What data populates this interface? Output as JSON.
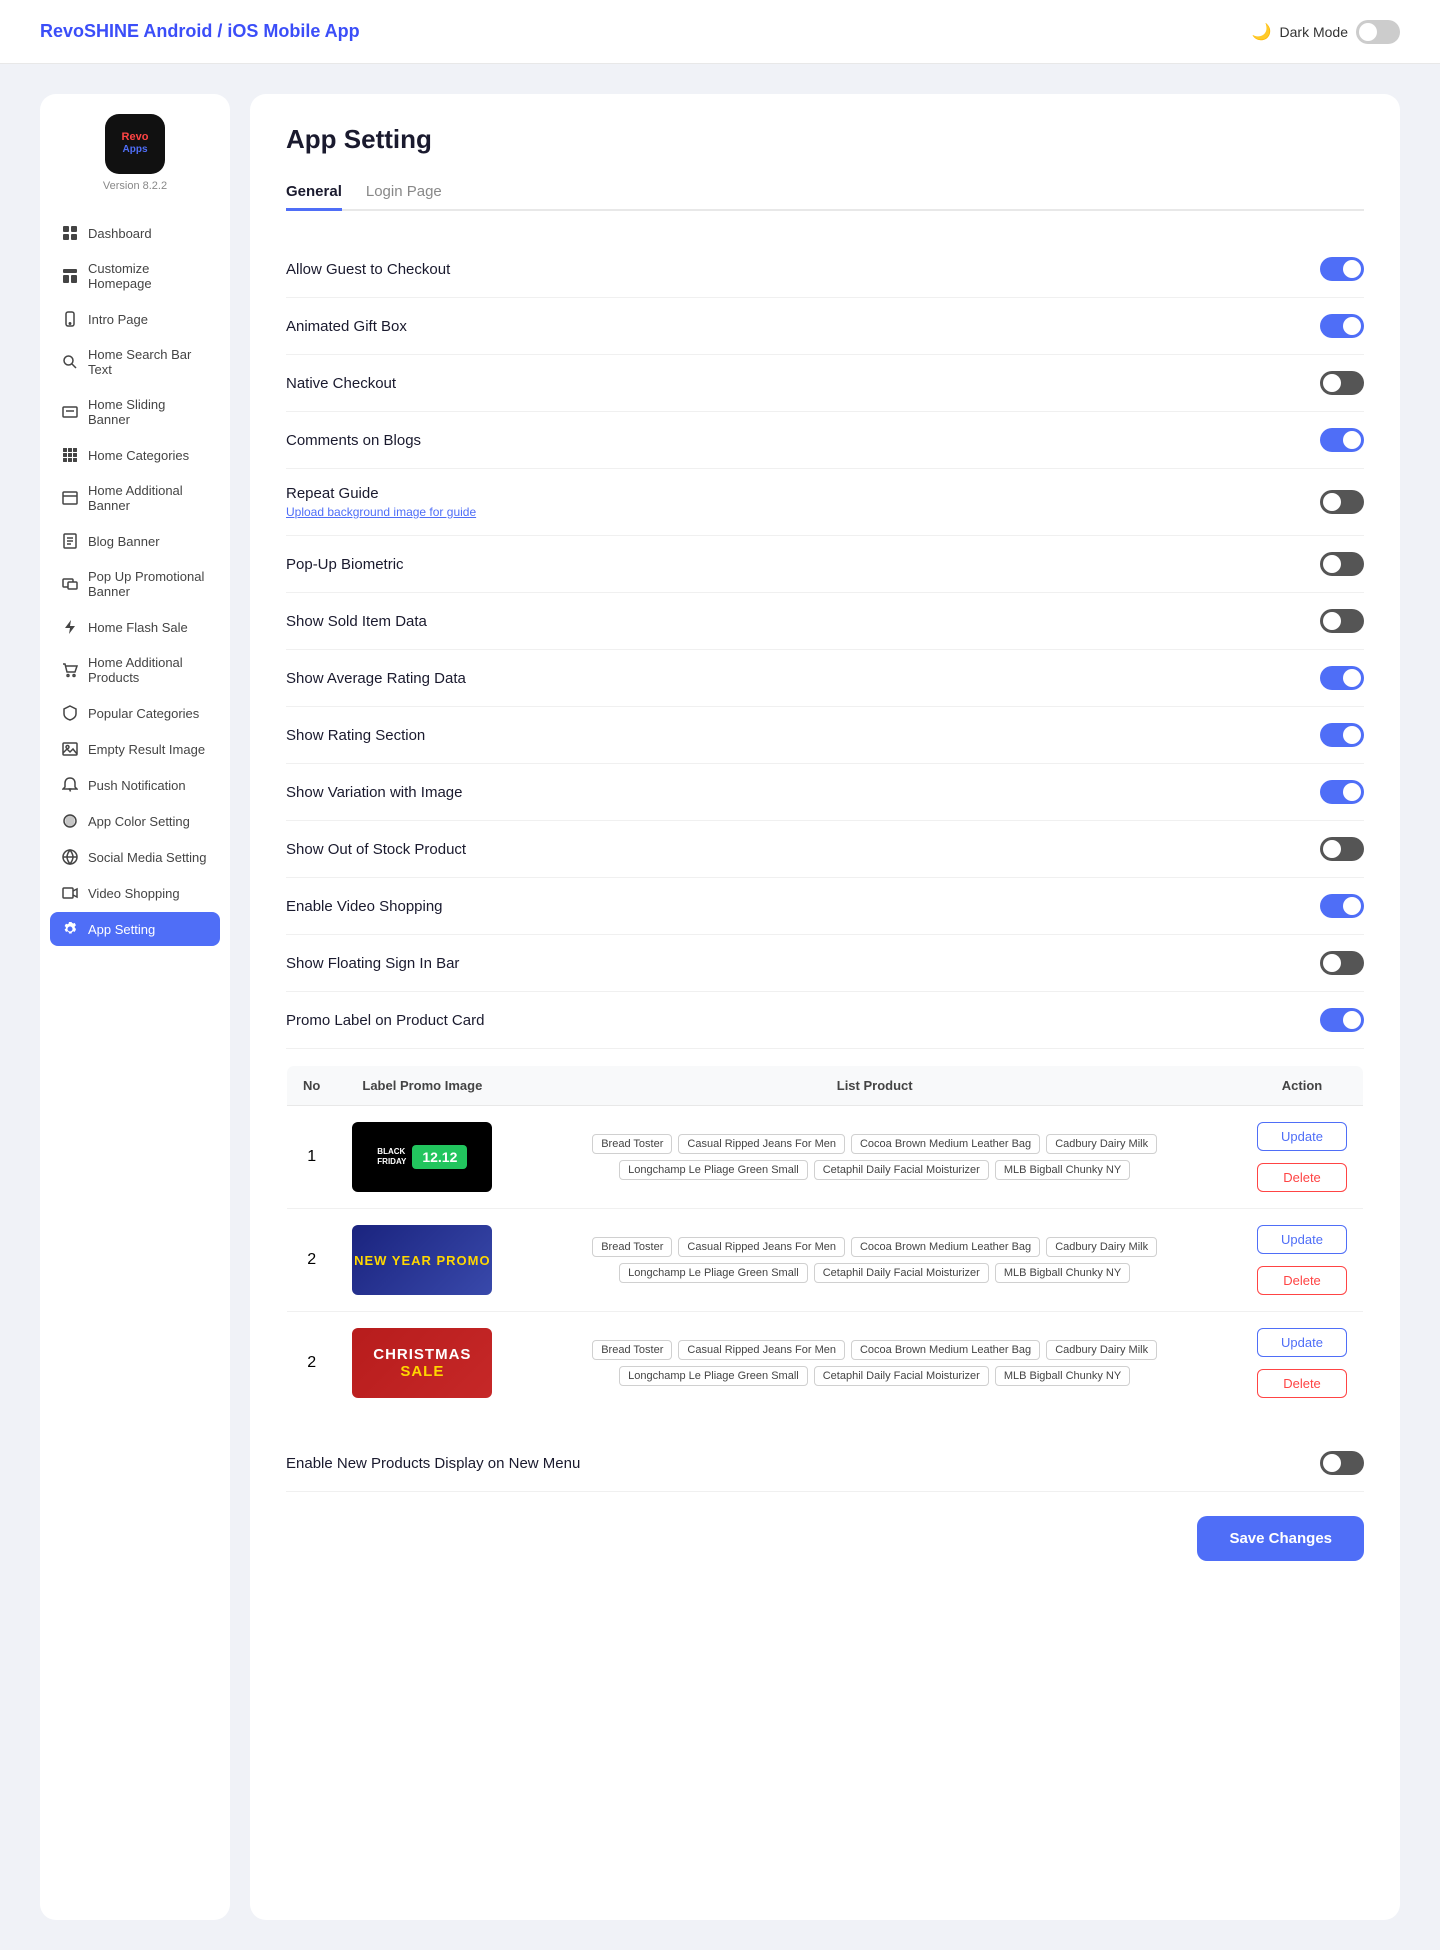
{
  "header": {
    "title": "RevoSHINE Android / iOS Mobile App",
    "darkMode": "Dark Mode"
  },
  "logo": {
    "version": "Version 8.2.2",
    "revo": "Revo",
    "apps": "Apps"
  },
  "nav": {
    "items": [
      {
        "id": "dashboard",
        "label": "Dashboard",
        "icon": "grid"
      },
      {
        "id": "customize-homepage",
        "label": "Customize Homepage",
        "icon": "layout"
      },
      {
        "id": "intro-page",
        "label": "Intro Page",
        "icon": "phone"
      },
      {
        "id": "home-search-bar",
        "label": "Home Search Bar Text",
        "icon": "search"
      },
      {
        "id": "home-sliding-banner",
        "label": "Home Sliding Banner",
        "icon": "image"
      },
      {
        "id": "home-categories",
        "label": "Home Categories",
        "icon": "grid4"
      },
      {
        "id": "home-additional-banner",
        "label": "Home Additional Banner",
        "icon": "banner"
      },
      {
        "id": "blog-banner",
        "label": "Blog Banner",
        "icon": "blog"
      },
      {
        "id": "popup-promotional",
        "label": "Pop Up Promotional Banner",
        "icon": "popup"
      },
      {
        "id": "home-flash-sale",
        "label": "Home Flash Sale",
        "icon": "flash"
      },
      {
        "id": "home-additional-products",
        "label": "Home Additional Products",
        "icon": "cart"
      },
      {
        "id": "popular-categories",
        "label": "Popular Categories",
        "icon": "shield"
      },
      {
        "id": "empty-result",
        "label": "Empty Result Image",
        "icon": "image2"
      },
      {
        "id": "push-notification",
        "label": "Push Notification",
        "icon": "bell"
      },
      {
        "id": "app-color-setting",
        "label": "App Color Setting",
        "icon": "color"
      },
      {
        "id": "social-media",
        "label": "Social Media Setting",
        "icon": "globe"
      },
      {
        "id": "video-shopping",
        "label": "Video Shopping",
        "icon": "video"
      },
      {
        "id": "app-setting",
        "label": "App Setting",
        "icon": "gear",
        "active": true
      }
    ]
  },
  "page": {
    "title": "App Setting",
    "tabs": [
      {
        "id": "general",
        "label": "General",
        "active": true
      },
      {
        "id": "login-page",
        "label": "Login Page",
        "active": false
      }
    ]
  },
  "settings": [
    {
      "id": "allow-guest",
      "label": "Allow Guest to Checkout",
      "enabled": true
    },
    {
      "id": "animated-gift",
      "label": "Animated Gift Box",
      "enabled": true
    },
    {
      "id": "native-checkout",
      "label": "Native Checkout",
      "enabled": false
    },
    {
      "id": "comments-blogs",
      "label": "Comments on Blogs",
      "enabled": true
    },
    {
      "id": "repeat-guide",
      "label": "Repeat Guide",
      "enabled": false,
      "sublabel": "Upload background image for guide"
    },
    {
      "id": "popup-biometric",
      "label": "Pop-Up Biometric",
      "enabled": false
    },
    {
      "id": "show-sold",
      "label": "Show Sold Item Data",
      "enabled": false
    },
    {
      "id": "show-avg-rating",
      "label": "Show Average Rating Data",
      "enabled": true
    },
    {
      "id": "show-rating",
      "label": "Show Rating Section",
      "enabled": true
    },
    {
      "id": "show-variation",
      "label": "Show Variation with Image",
      "enabled": true
    },
    {
      "id": "show-out-of-stock",
      "label": "Show Out of Stock Product",
      "enabled": false
    },
    {
      "id": "enable-video",
      "label": "Enable Video Shopping",
      "enabled": true
    },
    {
      "id": "floating-sign",
      "label": "Show Floating Sign In Bar",
      "enabled": false
    },
    {
      "id": "promo-label",
      "label": "Promo Label on Product Card",
      "enabled": true
    }
  ],
  "promoTable": {
    "headers": [
      "No",
      "Label Promo Image",
      "List Product",
      "Action"
    ],
    "rows": [
      {
        "no": "1",
        "type": "black-friday",
        "products": [
          "Bread Toster",
          "Casual Ripped Jeans For Men",
          "Cocoa Brown Medium Leather Bag",
          "Cadbury Dairy Milk",
          "Longchamp Le Pliage Green Small",
          "Cetaphil Daily Facial Moisturizer",
          "MLB Bigball Chunky NY"
        ]
      },
      {
        "no": "2",
        "type": "new-year",
        "products": [
          "Bread Toster",
          "Casual Ripped Jeans For Men",
          "Cocoa Brown Medium Leather Bag",
          "Cadbury Dairy Milk",
          "Longchamp Le Pliage Green Small",
          "Cetaphil Daily Facial Moisturizer",
          "MLB Bigball Chunky NY"
        ]
      },
      {
        "no": "2",
        "type": "christmas",
        "products": [
          "Bread Toster",
          "Casual Ripped Jeans For Men",
          "Cocoa Brown Medium Leather Bag",
          "Cadbury Dairy Milk",
          "Longchamp Le Pliage Green Small",
          "Cetaphil Daily Facial Moisturizer",
          "MLB Bigball Chunky NY"
        ]
      }
    ],
    "updateLabel": "Update",
    "deleteLabel": "Delete"
  },
  "bottomSettings": [
    {
      "id": "new-products-display",
      "label": "Enable New Products Display on New Menu",
      "enabled": false
    }
  ],
  "footer": {
    "saveLabel": "Save Changes"
  }
}
